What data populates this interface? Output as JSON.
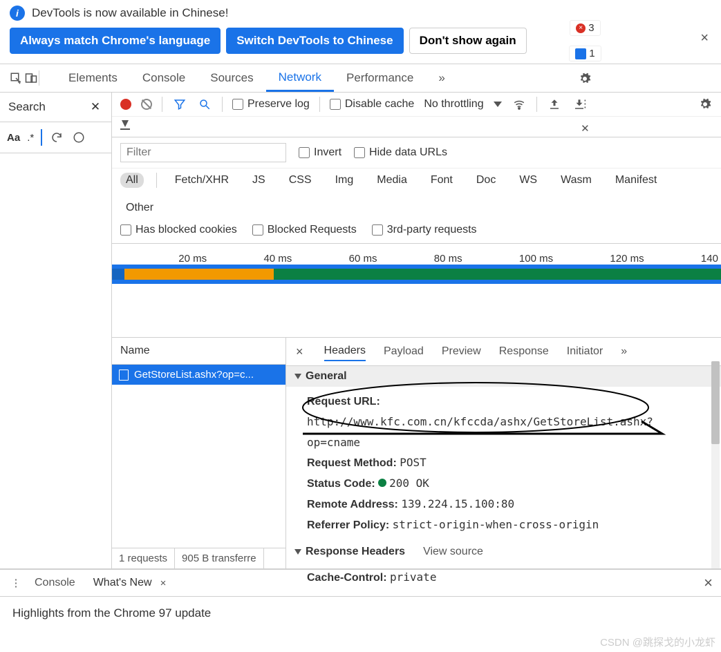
{
  "infobar": {
    "text": "DevTools is now available in Chinese!"
  },
  "banner": {
    "match": "Always match Chrome's language",
    "switch": "Switch DevTools to Chinese",
    "dont": "Don't show again"
  },
  "tabs": {
    "elements": "Elements",
    "console": "Console",
    "sources": "Sources",
    "network": "Network",
    "performance": "Performance",
    "more": "»"
  },
  "badges": {
    "errors": "3",
    "messages": "1"
  },
  "search": {
    "title": "Search",
    "aa": "Aa",
    "regex": ".*"
  },
  "netbar": {
    "preserve": "Preserve log",
    "disable": "Disable cache",
    "throttle": "No throttling"
  },
  "filter": {
    "placeholder": "Filter",
    "invert": "Invert",
    "hide": "Hide data URLs"
  },
  "types": [
    "All",
    "Fetch/XHR",
    "JS",
    "CSS",
    "Img",
    "Media",
    "Font",
    "Doc",
    "WS",
    "Wasm",
    "Manifest",
    "Other"
  ],
  "checks": {
    "blocked": "Has blocked cookies",
    "blockedReq": "Blocked Requests",
    "third": "3rd-party requests"
  },
  "ticks": [
    "20 ms",
    "40 ms",
    "60 ms",
    "80 ms",
    "100 ms",
    "120 ms",
    "140"
  ],
  "names": {
    "header": "Name",
    "item": "GetStoreList.ashx?op=c...",
    "requests": "1 requests",
    "transfer": "905 B transferre"
  },
  "detailTabs": {
    "headers": "Headers",
    "payload": "Payload",
    "preview": "Preview",
    "response": "Response",
    "initiator": "Initiator",
    "more": "»"
  },
  "general": {
    "title": "General",
    "requestUrlLabel": "Request URL:",
    "requestUrl": "http://www.kfc.com.cn/kfccda/ashx/GetStoreList.ashx?op=cname",
    "methodLabel": "Request Method:",
    "method": "POST",
    "statusLabel": "Status Code:",
    "status": "200 OK",
    "remoteLabel": "Remote Address:",
    "remote": "139.224.15.100:80",
    "refLabel": "Referrer Policy:",
    "ref": "strict-origin-when-cross-origin"
  },
  "respHead": {
    "title": "Response Headers",
    "viewSource": "View source",
    "cacheLabel": "Cache-Control:",
    "cache": "private"
  },
  "drawer": {
    "console": "Console",
    "whatsnew": "What's New",
    "highlights": "Highlights from the Chrome 97 update"
  },
  "watermark": "CSDN @跳探戈的小龙虾"
}
